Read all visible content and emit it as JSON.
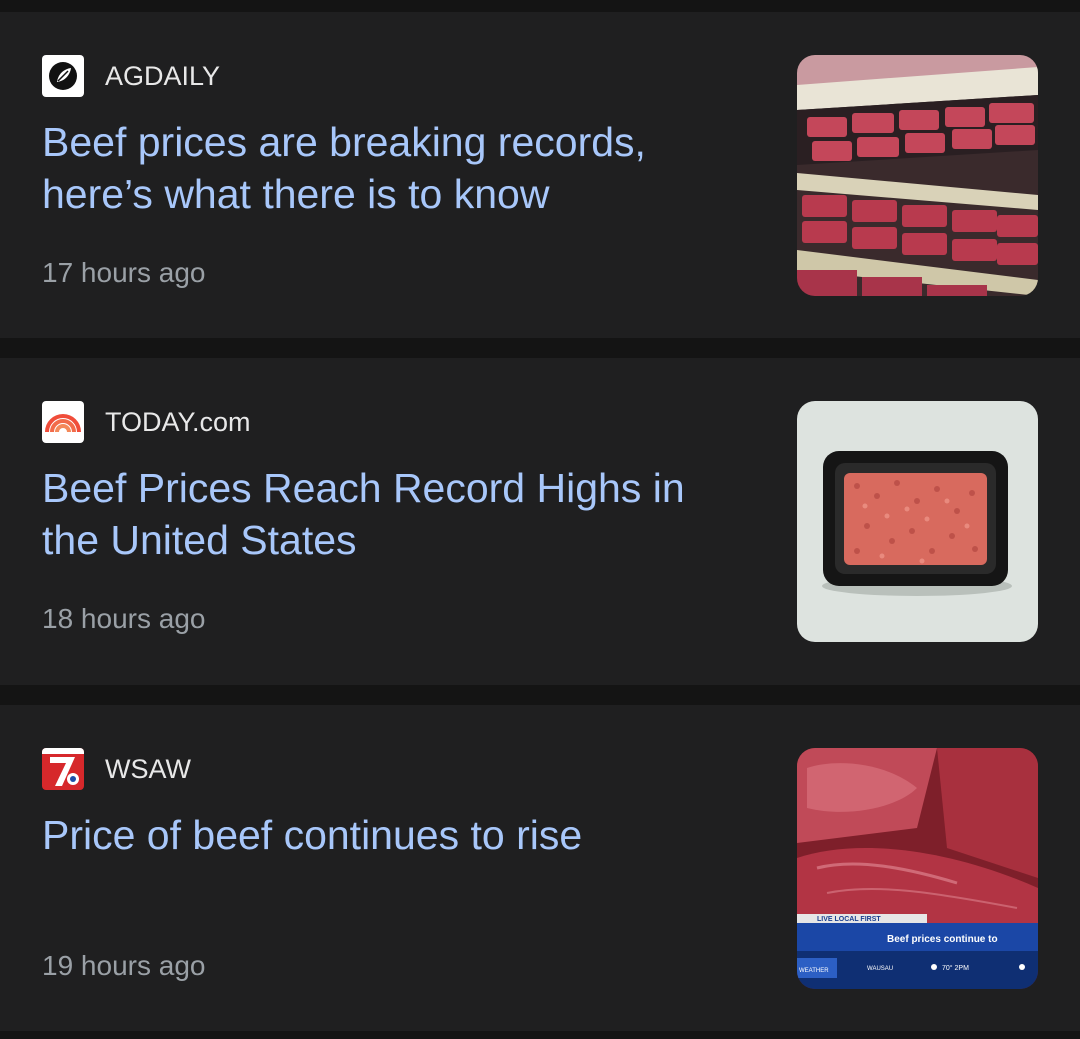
{
  "articles": [
    {
      "source": "AGDAILY",
      "headline": "Beef prices are breaking records, here’s what there is to know",
      "time": "17 hours ago",
      "favicon_icon": "agdaily-logo-icon",
      "thumbnail": "meat-shelves-image"
    },
    {
      "source": "TODAY.com",
      "headline": "Beef Prices Reach Record Highs in the United States",
      "time": "18 hours ago",
      "favicon_icon": "today-rainbow-logo-icon",
      "thumbnail": "ground-beef-tray-image"
    },
    {
      "source": "WSAW",
      "headline": "Price of beef continues to rise",
      "time": "19 hours ago",
      "favicon_icon": "wsaw-7-logo-icon",
      "thumbnail": "raw-steak-news-image",
      "thumbnail_ticker": {
        "tag": "LIVE LOCAL FIRST",
        "caption": "Beef prices continue to",
        "weather_label": "WEATHER",
        "city": "WAUSAU",
        "temp": "70° 2PM"
      }
    }
  ],
  "colors": {
    "background": "#141414",
    "card": "#1f1f20",
    "headline": "#a8c7fa",
    "source": "#e8e8e8",
    "time": "#9aa0a6"
  }
}
